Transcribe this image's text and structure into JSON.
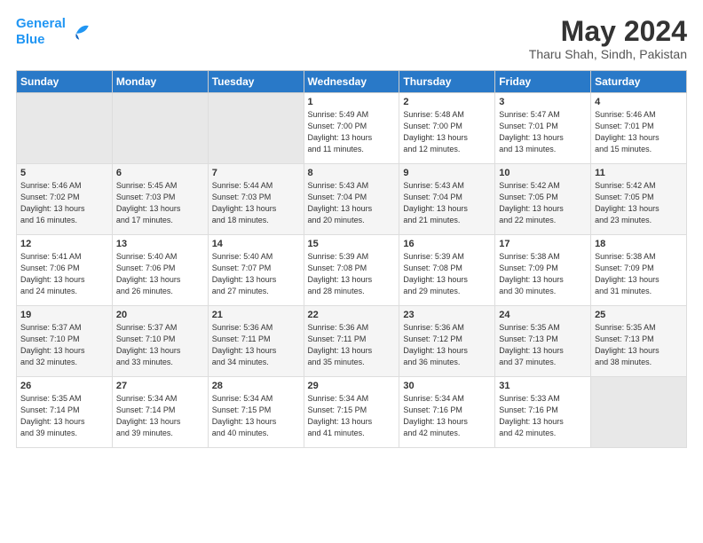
{
  "logo": {
    "line1": "General",
    "line2": "Blue"
  },
  "title": "May 2024",
  "location": "Tharu Shah, Sindh, Pakistan",
  "days_header": [
    "Sunday",
    "Monday",
    "Tuesday",
    "Wednesday",
    "Thursday",
    "Friday",
    "Saturday"
  ],
  "weeks": [
    [
      {
        "day": "",
        "content": ""
      },
      {
        "day": "",
        "content": ""
      },
      {
        "day": "",
        "content": ""
      },
      {
        "day": "1",
        "content": "Sunrise: 5:49 AM\nSunset: 7:00 PM\nDaylight: 13 hours\nand 11 minutes."
      },
      {
        "day": "2",
        "content": "Sunrise: 5:48 AM\nSunset: 7:00 PM\nDaylight: 13 hours\nand 12 minutes."
      },
      {
        "day": "3",
        "content": "Sunrise: 5:47 AM\nSunset: 7:01 PM\nDaylight: 13 hours\nand 13 minutes."
      },
      {
        "day": "4",
        "content": "Sunrise: 5:46 AM\nSunset: 7:01 PM\nDaylight: 13 hours\nand 15 minutes."
      }
    ],
    [
      {
        "day": "5",
        "content": "Sunrise: 5:46 AM\nSunset: 7:02 PM\nDaylight: 13 hours\nand 16 minutes."
      },
      {
        "day": "6",
        "content": "Sunrise: 5:45 AM\nSunset: 7:03 PM\nDaylight: 13 hours\nand 17 minutes."
      },
      {
        "day": "7",
        "content": "Sunrise: 5:44 AM\nSunset: 7:03 PM\nDaylight: 13 hours\nand 18 minutes."
      },
      {
        "day": "8",
        "content": "Sunrise: 5:43 AM\nSunset: 7:04 PM\nDaylight: 13 hours\nand 20 minutes."
      },
      {
        "day": "9",
        "content": "Sunrise: 5:43 AM\nSunset: 7:04 PM\nDaylight: 13 hours\nand 21 minutes."
      },
      {
        "day": "10",
        "content": "Sunrise: 5:42 AM\nSunset: 7:05 PM\nDaylight: 13 hours\nand 22 minutes."
      },
      {
        "day": "11",
        "content": "Sunrise: 5:42 AM\nSunset: 7:05 PM\nDaylight: 13 hours\nand 23 minutes."
      }
    ],
    [
      {
        "day": "12",
        "content": "Sunrise: 5:41 AM\nSunset: 7:06 PM\nDaylight: 13 hours\nand 24 minutes."
      },
      {
        "day": "13",
        "content": "Sunrise: 5:40 AM\nSunset: 7:06 PM\nDaylight: 13 hours\nand 26 minutes."
      },
      {
        "day": "14",
        "content": "Sunrise: 5:40 AM\nSunset: 7:07 PM\nDaylight: 13 hours\nand 27 minutes."
      },
      {
        "day": "15",
        "content": "Sunrise: 5:39 AM\nSunset: 7:08 PM\nDaylight: 13 hours\nand 28 minutes."
      },
      {
        "day": "16",
        "content": "Sunrise: 5:39 AM\nSunset: 7:08 PM\nDaylight: 13 hours\nand 29 minutes."
      },
      {
        "day": "17",
        "content": "Sunrise: 5:38 AM\nSunset: 7:09 PM\nDaylight: 13 hours\nand 30 minutes."
      },
      {
        "day": "18",
        "content": "Sunrise: 5:38 AM\nSunset: 7:09 PM\nDaylight: 13 hours\nand 31 minutes."
      }
    ],
    [
      {
        "day": "19",
        "content": "Sunrise: 5:37 AM\nSunset: 7:10 PM\nDaylight: 13 hours\nand 32 minutes."
      },
      {
        "day": "20",
        "content": "Sunrise: 5:37 AM\nSunset: 7:10 PM\nDaylight: 13 hours\nand 33 minutes."
      },
      {
        "day": "21",
        "content": "Sunrise: 5:36 AM\nSunset: 7:11 PM\nDaylight: 13 hours\nand 34 minutes."
      },
      {
        "day": "22",
        "content": "Sunrise: 5:36 AM\nSunset: 7:11 PM\nDaylight: 13 hours\nand 35 minutes."
      },
      {
        "day": "23",
        "content": "Sunrise: 5:36 AM\nSunset: 7:12 PM\nDaylight: 13 hours\nand 36 minutes."
      },
      {
        "day": "24",
        "content": "Sunrise: 5:35 AM\nSunset: 7:13 PM\nDaylight: 13 hours\nand 37 minutes."
      },
      {
        "day": "25",
        "content": "Sunrise: 5:35 AM\nSunset: 7:13 PM\nDaylight: 13 hours\nand 38 minutes."
      }
    ],
    [
      {
        "day": "26",
        "content": "Sunrise: 5:35 AM\nSunset: 7:14 PM\nDaylight: 13 hours\nand 39 minutes."
      },
      {
        "day": "27",
        "content": "Sunrise: 5:34 AM\nSunset: 7:14 PM\nDaylight: 13 hours\nand 39 minutes."
      },
      {
        "day": "28",
        "content": "Sunrise: 5:34 AM\nSunset: 7:15 PM\nDaylight: 13 hours\nand 40 minutes."
      },
      {
        "day": "29",
        "content": "Sunrise: 5:34 AM\nSunset: 7:15 PM\nDaylight: 13 hours\nand 41 minutes."
      },
      {
        "day": "30",
        "content": "Sunrise: 5:34 AM\nSunset: 7:16 PM\nDaylight: 13 hours\nand 42 minutes."
      },
      {
        "day": "31",
        "content": "Sunrise: 5:33 AM\nSunset: 7:16 PM\nDaylight: 13 hours\nand 42 minutes."
      },
      {
        "day": "",
        "content": ""
      }
    ]
  ]
}
